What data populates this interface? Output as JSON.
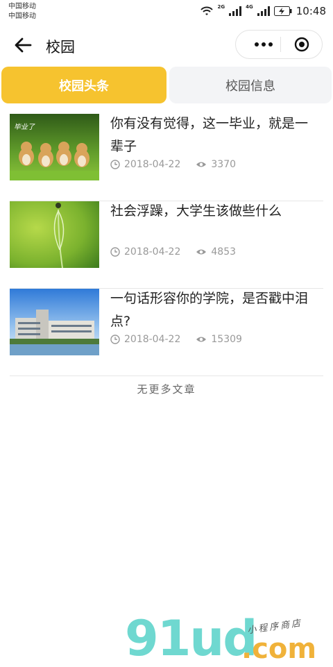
{
  "status_bar": {
    "carrier_1": "中国移动",
    "carrier_2": "中国移动",
    "net_1": "2G",
    "net_2": "4G",
    "time": "10:48"
  },
  "nav": {
    "title": "校园",
    "icons": {
      "back": "arrow-left-icon",
      "more": "more-dots-icon",
      "close": "target-close-icon"
    }
  },
  "tabs": [
    {
      "label": "校园头条",
      "active": true
    },
    {
      "label": "校园信息",
      "active": false
    }
  ],
  "articles": [
    {
      "title": "你有没有觉得，这一毕业，就是一辈子",
      "date": "2018-04-22",
      "views": "3370",
      "thumb_text": "毕业了"
    },
    {
      "title": "社会浮躁，大学生该做些什么",
      "date": "2018-04-22",
      "views": "4853"
    },
    {
      "title": "一句话形容你的学院，是否戳中泪点?",
      "date": "2018-04-22",
      "views": "15309"
    }
  ],
  "footer_text": "无更多文章",
  "watermark": {
    "logo": "91ud",
    "domain": ".com",
    "tagline": "小程序商店"
  },
  "colors": {
    "accent": "#f6c32f",
    "tab_inactive_bg": "#f3f4f6",
    "meta_text": "#999999"
  }
}
